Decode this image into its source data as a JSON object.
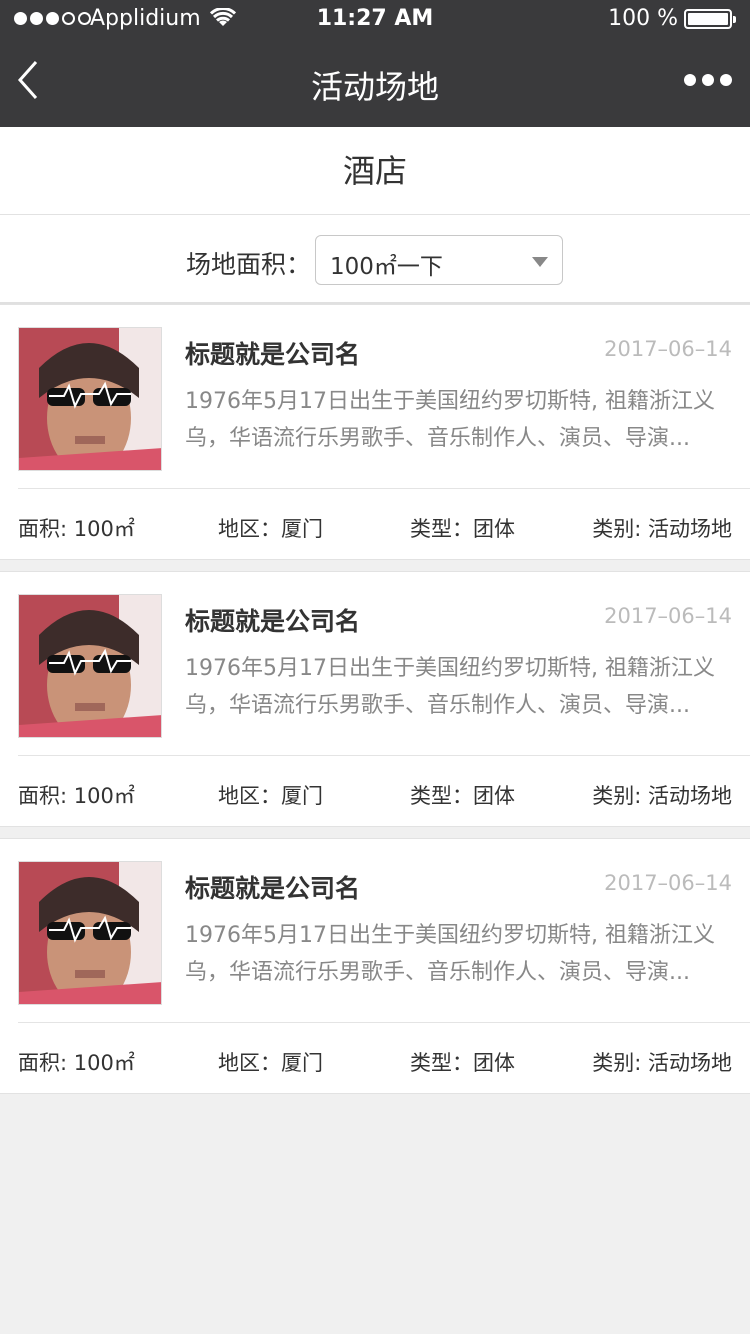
{
  "status": {
    "carrier": "Applidium",
    "time": "11:27 AM",
    "battery": "100 %"
  },
  "nav": {
    "title": "活动场地"
  },
  "category": {
    "title": "酒店"
  },
  "filter": {
    "label": "场地面积：",
    "selected": "100㎡一下"
  },
  "cards": [
    {
      "title": "标题就是公司名",
      "date": "2017–06–14",
      "desc": "1976年5月17日出生于美国纽约罗切斯特, 祖籍浙江义乌，华语流行乐男歌手、音乐制作人、演员、导演...",
      "area": "面积: 100㎡",
      "region": "地区：厦门",
      "type": "类型：团体",
      "category": "类别: 活动场地"
    },
    {
      "title": "标题就是公司名",
      "date": "2017–06–14",
      "desc": "1976年5月17日出生于美国纽约罗切斯特, 祖籍浙江义乌，华语流行乐男歌手、音乐制作人、演员、导演...",
      "area": "面积: 100㎡",
      "region": "地区：厦门",
      "type": "类型：团体",
      "category": "类别: 活动场地"
    },
    {
      "title": "标题就是公司名",
      "date": "2017–06–14",
      "desc": "1976年5月17日出生于美国纽约罗切斯特, 祖籍浙江义乌，华语流行乐男歌手、音乐制作人、演员、导演...",
      "area": "面积: 100㎡",
      "region": "地区：厦门",
      "type": "类型：团体",
      "category": "类别: 活动场地"
    }
  ],
  "icons": {
    "back": "back-chevron-icon",
    "more": "more-dots-icon",
    "wifi": "wifi-icon",
    "battery": "battery-icon",
    "dropdown": "dropdown-caret-icon"
  }
}
